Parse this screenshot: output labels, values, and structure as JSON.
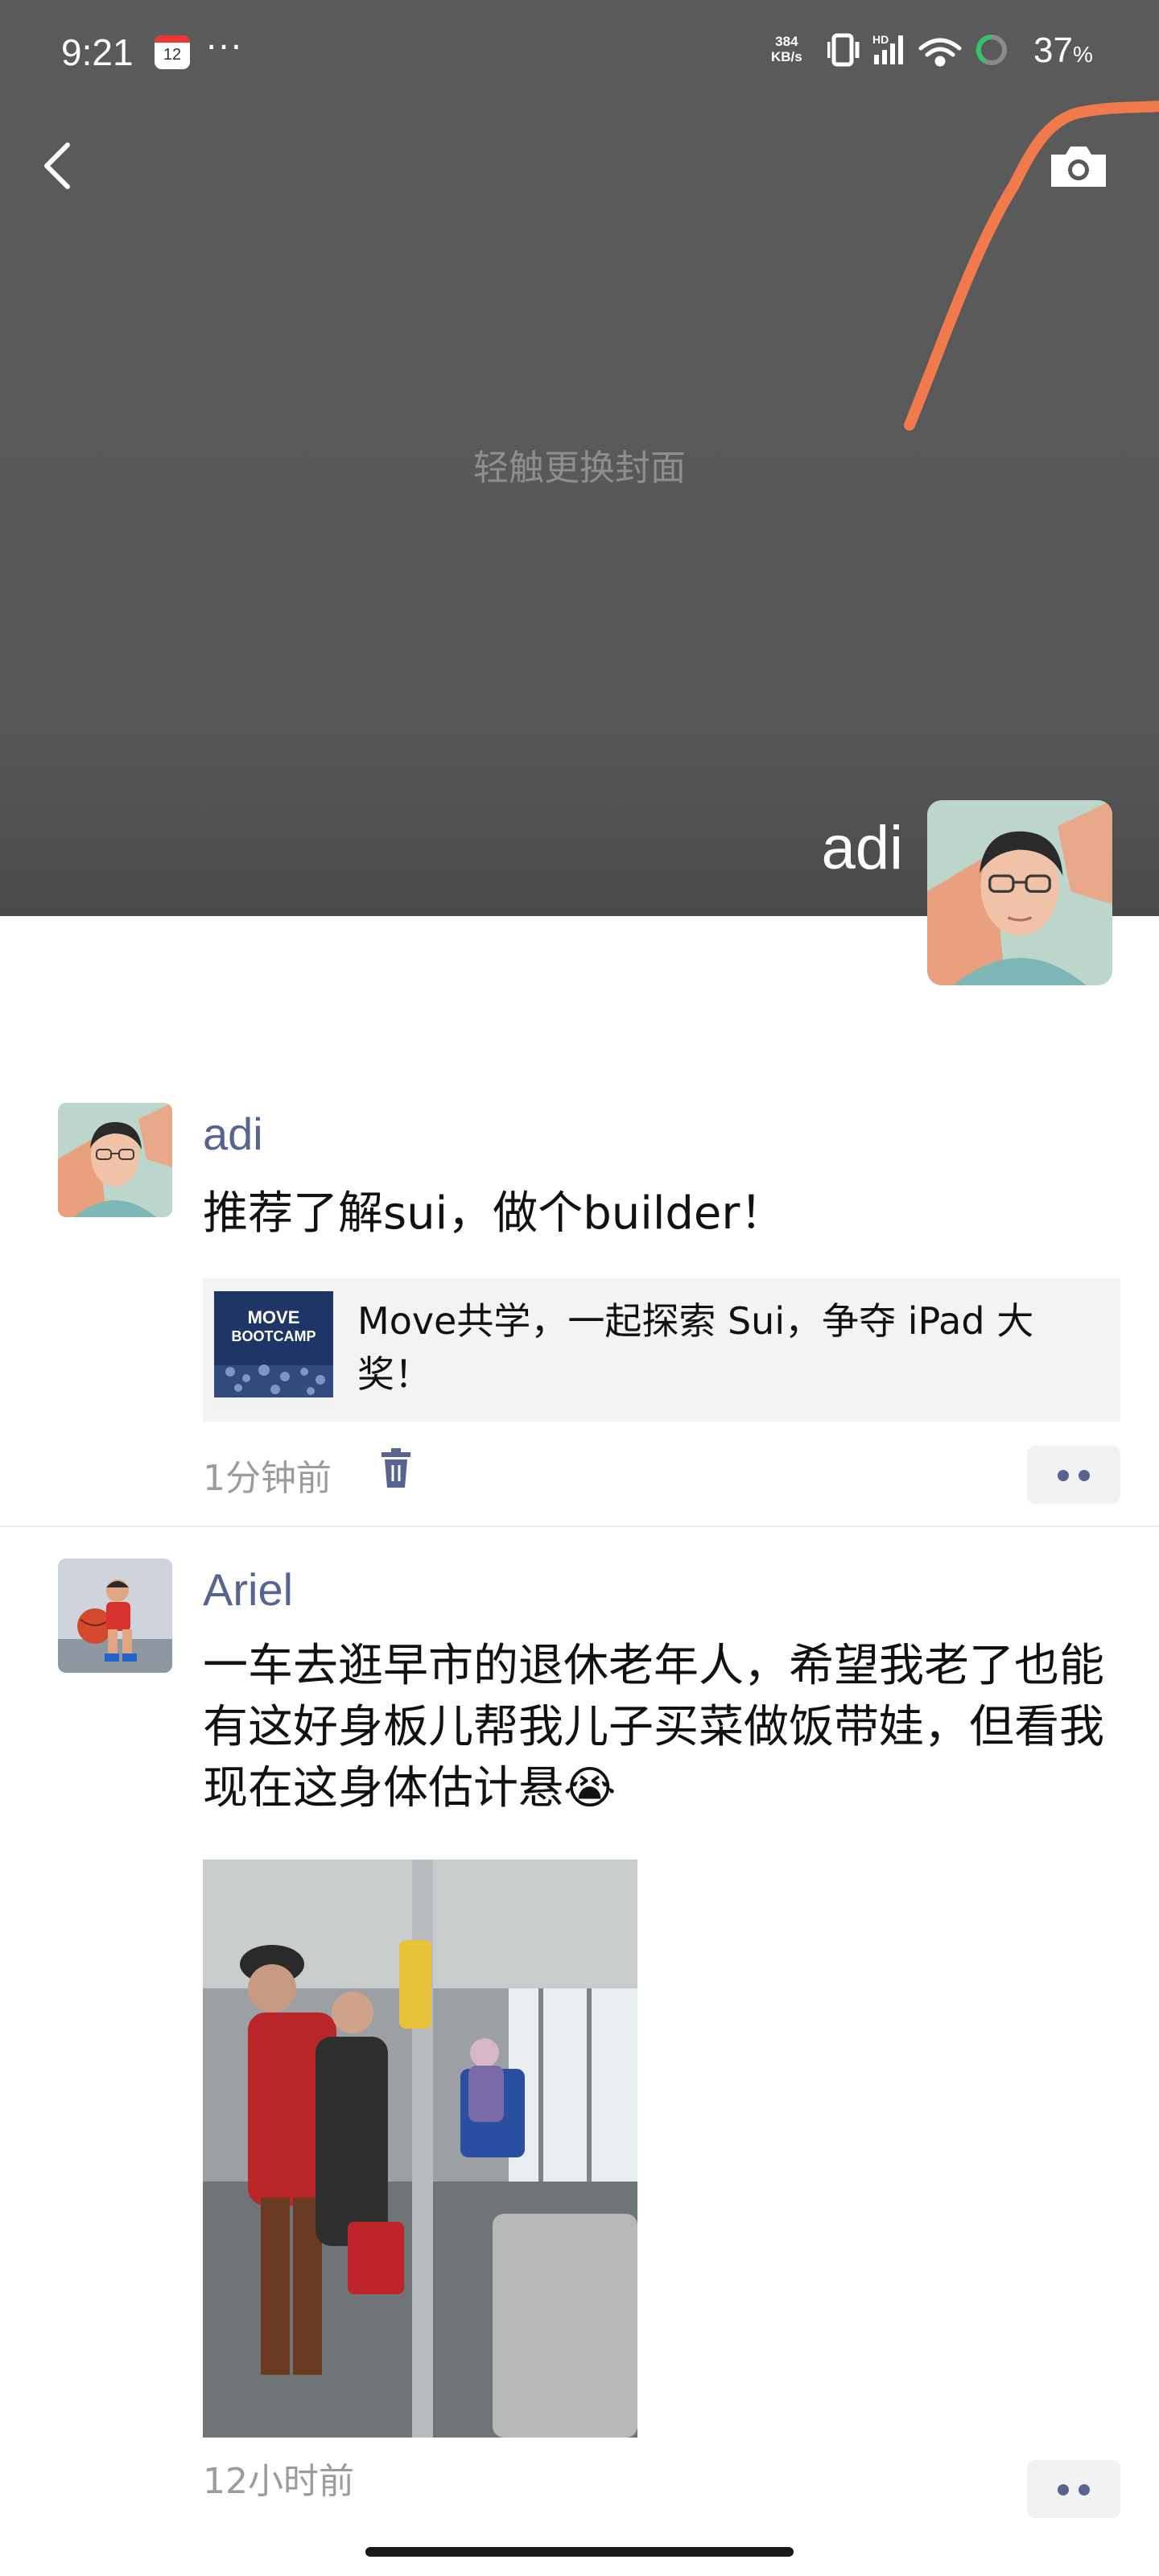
{
  "status_bar": {
    "time": "9:21",
    "calendar_day": "12",
    "overflow": "···",
    "net_speed_value": "384",
    "net_speed_unit": "KB/s",
    "battery_value": "37",
    "battery_unit": "%"
  },
  "cover": {
    "hint": "轻触更换封面",
    "profile_name": "adi",
    "stroke_color": "#f07a4b"
  },
  "posts": [
    {
      "author": "adi",
      "text": "推荐了解sui，做个builder！",
      "link": {
        "title": "Move共学，一起探索 Sui，争夺 iPad 大奖！",
        "thumb_text_1": "MOVE",
        "thumb_text_2": "BOOTCAMP"
      },
      "time": "1分钟前"
    },
    {
      "author": "Ariel",
      "text": "一车去逛早市的退休老年人，希望我老了也能有这好身板儿帮我儿子买菜做饭带娃，但看我现在这身体估计悬",
      "emoji": "😭",
      "time": "12小时前"
    }
  ],
  "colors": {
    "author_name": "#56648f",
    "cover_bg": "#585858",
    "accent_orange": "#f07a4b"
  }
}
